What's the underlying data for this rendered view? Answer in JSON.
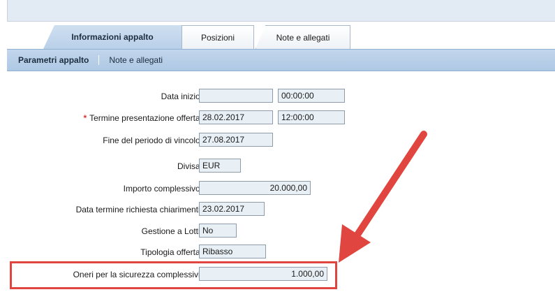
{
  "tabs": {
    "active": "Informazioni appalto",
    "positions": "Posizioni",
    "notes": "Note e allegati"
  },
  "subnav": {
    "item1": "Parametri appalto",
    "item2": "Note e allegati"
  },
  "form": {
    "data_inizio": {
      "label": "Data inizio:",
      "date": "",
      "time": "00:00:00"
    },
    "termine": {
      "required_mark": "*",
      "label": "Termine presentazione offerta:",
      "date": "28.02.2017",
      "time": "12:00:00"
    },
    "fine_vincolo": {
      "label": "Fine del periodo di vincolo:",
      "value": "27.08.2017"
    },
    "divisa": {
      "label": "Divisa:",
      "value": "EUR"
    },
    "importo": {
      "label": "Importo complessivo:",
      "value": "20.000,00"
    },
    "chiarimenti": {
      "label": "Data termine richiesta chiarimenti:",
      "value": "23.02.2017"
    },
    "lotti": {
      "label": "Gestione a Lotti:",
      "value": "No"
    },
    "tipologia": {
      "label": "Tipologia offerta:",
      "value": "Ribasso"
    },
    "oneri": {
      "label": "Oneri per la sicurezza complessivi:",
      "value": "1.000,00"
    }
  },
  "annotation": {
    "color": "#e0453f",
    "arrow_icon": "arrow-down-left-icon"
  }
}
